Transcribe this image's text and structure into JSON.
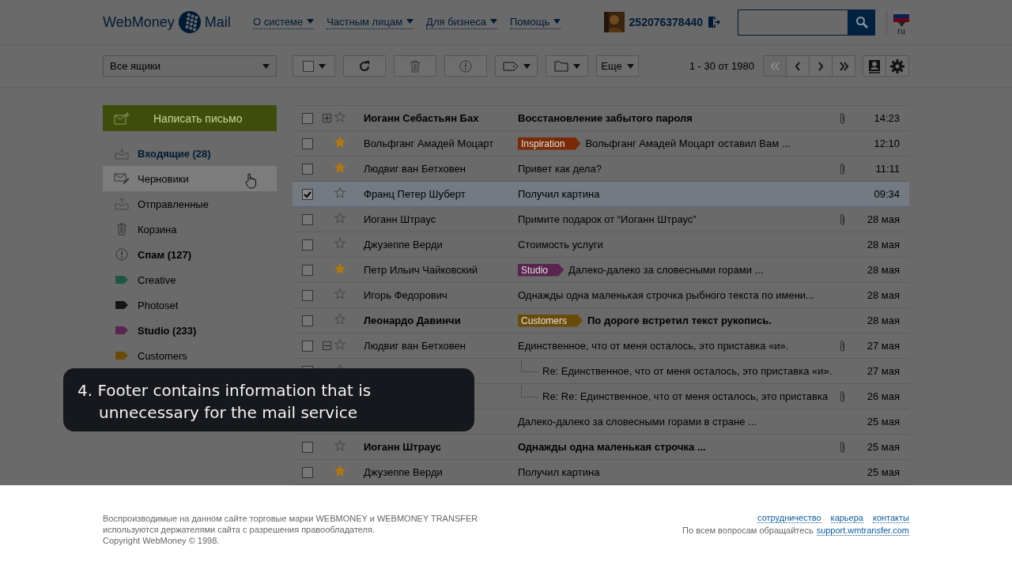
{
  "header": {
    "logo": {
      "brand": "WebMoney",
      "product": "Mail"
    },
    "nav": [
      "О системе",
      "Частным лицам",
      "Для бизнеса",
      "Помощь"
    ],
    "user": {
      "id": "252076378440"
    },
    "language": "ru"
  },
  "toolbar": {
    "mailbox": "Все ящики",
    "more": "Еще",
    "range": "1 - 30 от 1980",
    "pager": [
      {
        "kind": "first",
        "disabled": true
      },
      {
        "kind": "prev",
        "disabled": false
      },
      {
        "kind": "next",
        "disabled": false
      },
      {
        "kind": "last",
        "disabled": false
      }
    ]
  },
  "compose": "Написать письмо",
  "folders": [
    {
      "kind": "inbox",
      "label": "Входящие (28)",
      "unread": true,
      "selected": true,
      "hovered": false
    },
    {
      "kind": "drafts",
      "label": "Черновики",
      "unread": false,
      "selected": false,
      "hovered": true
    },
    {
      "kind": "sent",
      "label": "Отправленные",
      "unread": false,
      "selected": false,
      "hovered": false
    },
    {
      "kind": "trash",
      "label": "Корзина",
      "unread": false,
      "selected": false,
      "hovered": false
    },
    {
      "kind": "spam",
      "label": "Спам (127)",
      "unread": true,
      "selected": false,
      "hovered": false
    },
    {
      "kind": "tag",
      "label": "Creative",
      "color": "#1f5446",
      "unread": false,
      "selected": false,
      "hovered": false
    },
    {
      "kind": "tag",
      "label": "Photoset",
      "color": "#151515",
      "unread": false,
      "selected": false,
      "hovered": false
    },
    {
      "kind": "tag",
      "label": "Studio (233)",
      "color": "#5a2450",
      "unread": true,
      "selected": false,
      "hovered": false
    },
    {
      "kind": "tag",
      "label": "Customers",
      "color": "#6a4c0a",
      "unread": false,
      "selected": false,
      "hovered": false
    }
  ],
  "rows": [
    {
      "checked": false,
      "thread": {
        "expanded": false
      },
      "reply": false,
      "starred": false,
      "sender": "Иоганн Себастьян Бах",
      "subject": "Восстановление забытого пароля",
      "attachment": true,
      "time": "14:23",
      "unread": true
    },
    {
      "checked": false,
      "reply": false,
      "starred": true,
      "sender": "Вольфганг Амадей Моцарт",
      "tag": {
        "label": "Inspiration",
        "color": "#7a2a06"
      },
      "subject": "Вольфганг Амадей Моцарт оставил Вам ...",
      "attachment": false,
      "time": "12:10",
      "unread": false
    },
    {
      "checked": false,
      "reply": false,
      "starred": true,
      "sender": "Людвиг ван Бетховен",
      "subject": "Привет как дела?",
      "attachment": true,
      "time": "11:11",
      "unread": false
    },
    {
      "checked": true,
      "reply": false,
      "starred": false,
      "sender": "Франц Петер Шуберт",
      "subject": "Получил картина",
      "attachment": false,
      "time": "09:34",
      "unread": false
    },
    {
      "checked": false,
      "reply": false,
      "starred": false,
      "sender": "Иоганн Штраус",
      "subject": "Примите подарок от “Иоганн Штраус”",
      "attachment": true,
      "time": "28 мая",
      "unread": false
    },
    {
      "checked": false,
      "reply": false,
      "starred": false,
      "sender": "Джузеппе Верди",
      "subject": "Стоимость услуги",
      "attachment": false,
      "time": "28 мая",
      "unread": false
    },
    {
      "checked": false,
      "reply": false,
      "starred": true,
      "sender": "Петр Ильич Чайковский",
      "tag": {
        "label": "Studio",
        "color": "#5a2450"
      },
      "subject": "Далеко-далеко за словесными горами ...",
      "attachment": false,
      "time": "28 мая",
      "unread": false
    },
    {
      "checked": false,
      "reply": false,
      "starred": false,
      "sender": "Игорь Федорович",
      "subject": "Однажды одна маленькая строчка рыбного текста по имени...",
      "attachment": false,
      "time": "28 мая",
      "unread": false
    },
    {
      "checked": false,
      "reply": false,
      "starred": false,
      "sender": "Леонардо Давинчи",
      "tag": {
        "label": "Customers",
        "color": "#6a4c0a"
      },
      "subject": "По дороге встретил текст рукопись.",
      "attachment": false,
      "time": "28 мая",
      "unread": true
    },
    {
      "checked": false,
      "thread": {
        "expanded": true
      },
      "reply": false,
      "starred": false,
      "sender": "Людвиг ван Бетховен",
      "subject": "Единственное, что от меня осталось, это приставка «и».",
      "attachment": true,
      "time": "27 мая",
      "unread": false
    },
    {
      "checked": false,
      "reply": true,
      "starred": false,
      "subject": "Re: Единственное, что от меня осталось, это приставка «и».",
      "attachment": false,
      "time": "27 мая",
      "unread": false
    },
    {
      "reply": true,
      "subject": "Re: Re: Единственное, что от меня осталось, это приставка",
      "attachment": true,
      "time": "26 мая",
      "unread": false
    },
    {
      "reply": false,
      "subject": "Далеко-далеко за словесными горами в стране ...",
      "attachment": false,
      "time": "25 мая",
      "unread": false
    },
    {
      "checked": false,
      "reply": false,
      "starred": false,
      "sender": "Иоганн Штраус",
      "subject": "Однажды одна маленькая строчка ...",
      "attachment": true,
      "time": "25 мая",
      "unread": true
    },
    {
      "checked": false,
      "reply": false,
      "starred": true,
      "sender": "Джузеппе Верди",
      "subject": "Получил картина",
      "attachment": false,
      "time": "25 мая",
      "unread": false
    }
  ],
  "callout": "4. Footer contains information that is unnecessary for the mail service",
  "footer": {
    "notice": [
      "Воспроизводимые на данном сайте торговые марки WEBMONEY и WEBMONEY TRANSFER",
      "используются держателями сайта с разрешения правообладателя.",
      "Copyright WebMoney © 1998."
    ],
    "links": [
      "сотрудничество",
      "карьера",
      "контакты"
    ],
    "support_text": "По всем вопросам обращайтесь",
    "support_link": "support.wmtransfer.com"
  }
}
